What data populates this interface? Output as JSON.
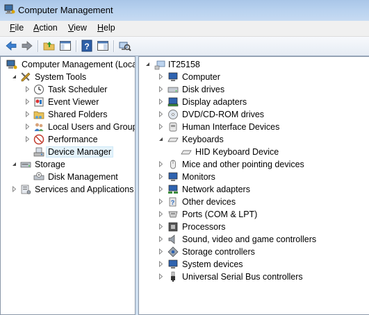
{
  "window": {
    "title": "Computer Management"
  },
  "menu": {
    "file": "F",
    "file_rest": "ile",
    "action": "A",
    "action_rest": "ction",
    "view": "V",
    "view_rest": "iew",
    "help": "H",
    "help_rest": "elp"
  },
  "left_tree": {
    "root": "Computer Management (Local",
    "system_tools": "System Tools",
    "task_scheduler": "Task Scheduler",
    "event_viewer": "Event Viewer",
    "shared_folders": "Shared Folders",
    "local_users": "Local Users and Groups",
    "performance": "Performance",
    "device_manager": "Device Manager",
    "storage": "Storage",
    "disk_management": "Disk Management",
    "services": "Services and Applications"
  },
  "device_tree": {
    "root": "IT25158",
    "categories": [
      "Computer",
      "Disk drives",
      "Display adapters",
      "DVD/CD-ROM drives",
      "Human Interface Devices",
      "Keyboards",
      "HID Keyboard Device",
      "Mice and other pointing devices",
      "Monitors",
      "Network adapters",
      "Other devices",
      "Ports (COM & LPT)",
      "Processors",
      "Sound, video and game controllers",
      "Storage controllers",
      "System devices",
      "Universal Serial Bus controllers"
    ]
  },
  "colors": {
    "title_bar": "#b9d2ef",
    "pane_border": "#8a97a8",
    "selection": "#e5f3fb"
  },
  "icons": {
    "toolbar": [
      "back-arrow-icon",
      "forward-arrow-icon",
      "up-folder-icon",
      "show-hide-tree-icon",
      "help-icon",
      "console-pane-icon",
      "device-scan-icon"
    ]
  }
}
